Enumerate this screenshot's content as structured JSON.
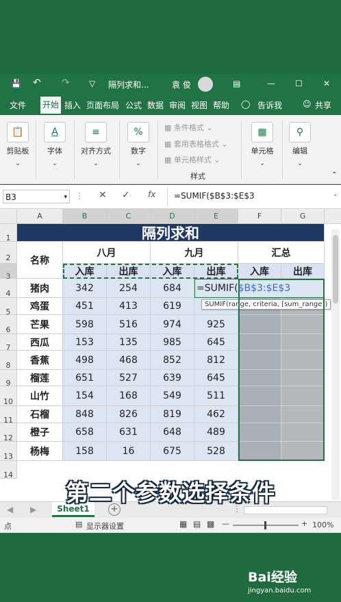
{
  "titlebar": {
    "filename": "隔列求和...",
    "user": "袁 俊"
  },
  "ribbon_tabs": [
    "文件",
    "开始",
    "插入",
    "页面布局",
    "公式",
    "数据",
    "审阅",
    "视图",
    "帮助"
  ],
  "ribbon_tab_active": "开始",
  "ribbon_extra": {
    "tell": "告诉我",
    "share": "共享"
  },
  "ribbon": {
    "clipboard": "剪贴板",
    "font": "字体",
    "align": "对齐方式",
    "number": "数字",
    "cond_format": "条件格式",
    "table_format": "套用表格格式",
    "cell_style": "单元格样式",
    "styles_group": "样式",
    "cells": "单元格",
    "editing": "编辑"
  },
  "formulabar": {
    "namebox": "B3",
    "fx": "fx",
    "formula": "=SUMIF($B$3:$E$3"
  },
  "columns": [
    "A",
    "B",
    "C",
    "D",
    "E",
    "F",
    "G"
  ],
  "rows": [
    "1",
    "2",
    "3",
    "4",
    "5",
    "6",
    "7",
    "8",
    "9",
    "10",
    "11",
    "12",
    "13",
    "14"
  ],
  "sheet": {
    "title": "隔列求和",
    "name_header": "名称",
    "group_aug": "八月",
    "group_sep": "九月",
    "group_total": "汇总",
    "in": "入库",
    "out": "出库",
    "editing_text": "=SUMIF(",
    "editing_ref": "$B$3:$E$3",
    "tooltip": "SUMIF(range, criteria, [sum_range])",
    "items": [
      {
        "name": "猪肉",
        "v": [
          "342",
          "254",
          "684",
          ""
        ]
      },
      {
        "name": "鸡蛋",
        "v": [
          "451",
          "413",
          "619",
          ""
        ]
      },
      {
        "name": "芒果",
        "v": [
          "598",
          "516",
          "974",
          "925"
        ]
      },
      {
        "name": "西瓜",
        "v": [
          "153",
          "135",
          "985",
          "645"
        ]
      },
      {
        "name": "香蕉",
        "v": [
          "498",
          "468",
          "852",
          "812"
        ]
      },
      {
        "name": "榴莲",
        "v": [
          "651",
          "527",
          "639",
          "645"
        ]
      },
      {
        "name": "山竹",
        "v": [
          "154",
          "168",
          "549",
          "511"
        ]
      },
      {
        "name": "石榴",
        "v": [
          "848",
          "826",
          "819",
          "462"
        ]
      },
      {
        "name": "橙子",
        "v": [
          "658",
          "631",
          "648",
          "489"
        ]
      },
      {
        "name": "杨梅",
        "v": [
          "158",
          "16",
          "675",
          "528"
        ]
      }
    ]
  },
  "sheet_tab": "Sheet1",
  "status": {
    "mode": "点",
    "display": "显示器设置",
    "zoom": "100%"
  },
  "caption": "第二个参数选择条件",
  "watermark": {
    "brand": "Bai经验",
    "url": "jingyan.baidu.com"
  },
  "colors": {
    "excel_green": "#217346",
    "title_navy": "#203864",
    "header_blue": "#d9e1f2",
    "total_grey": "#a6a6a6"
  }
}
